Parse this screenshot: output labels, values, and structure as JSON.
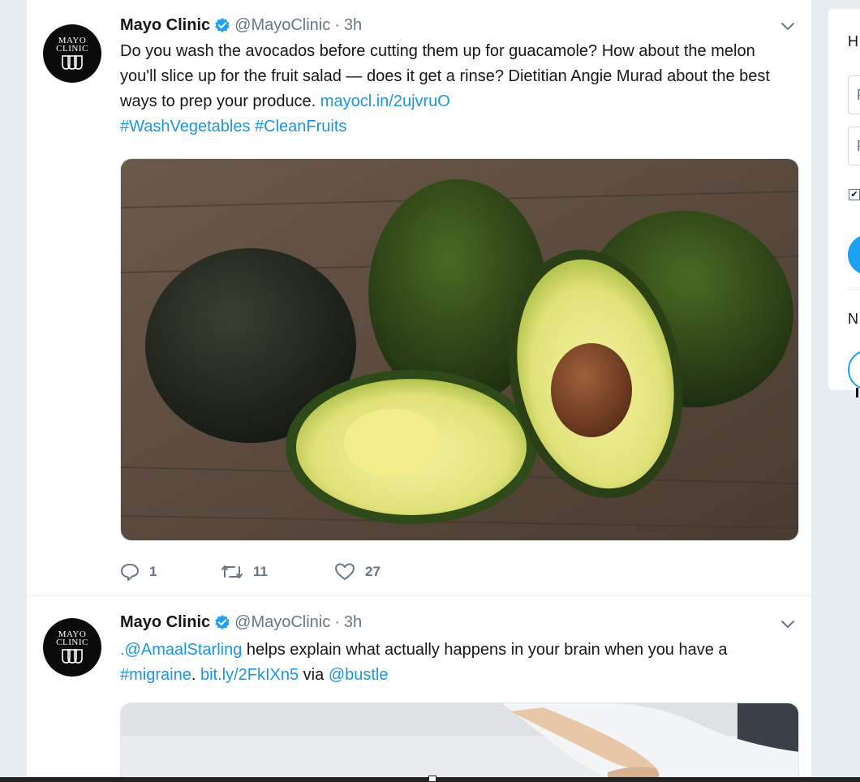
{
  "tweets": [
    {
      "avatar": {
        "line1": "MAYO",
        "line2": "CLINIC"
      },
      "name": "Mayo Clinic",
      "handle": "@MayoClinic",
      "separator": "·",
      "time": "3h",
      "text_part1": "Do you wash the avocados before cutting them up for guacamole? How about the melon you'll slice up for the fruit salad — does it get a rinse?  Dietitian Angie Murad about the best ways to prep your produce. ",
      "link": "mayocl.in/2ujvruO",
      "hashtag1": "#WashVegetables",
      "hashtag2": "#CleanFruits",
      "media_description_icon": "avocado-photo",
      "reply_count": "1",
      "retweet_count": "11",
      "like_count": "27"
    },
    {
      "avatar": {
        "line1": "MAYO",
        "line2": "CLINIC"
      },
      "name": "Mayo Clinic",
      "handle": "@MayoClinic",
      "separator": "·",
      "time": "3h",
      "mention": ".@AmaalStarling",
      "text_part1": " helps explain what actually happens in your brain when you have a ",
      "hashtag": "#migraine",
      "text_part2": ". ",
      "link": "bit.ly/2FkIXn5",
      "text_part3": " via ",
      "mention2": "@bustle",
      "media_description_icon": "bed-photo"
    }
  ],
  "sidebar": {
    "heading_initial": "H",
    "field1_initial": "F",
    "field2_initial": "F",
    "section2_initial": "N"
  },
  "colors": {
    "accent": "#1b95e0",
    "verified": "#1da1f2",
    "muted": "#657786",
    "background": "#e6ecf0"
  }
}
